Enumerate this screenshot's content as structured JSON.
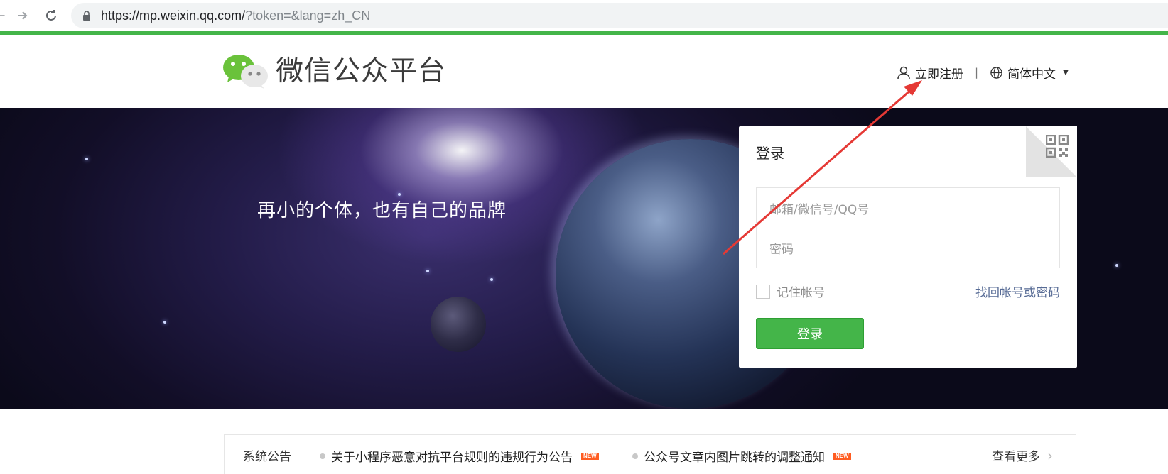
{
  "browser": {
    "url_host": "https://mp.weixin.qq.com/",
    "url_rest": "?token=&lang=zh_CN"
  },
  "header": {
    "brand_name": "微信公众平台",
    "register_label": "立即注册",
    "language_label": "简体中文",
    "separator": "|"
  },
  "banner": {
    "slogan": "再小的个体，也有自己的品牌"
  },
  "login": {
    "title": "登录",
    "account_placeholder": "邮箱/微信号/QQ号",
    "password_placeholder": "密码",
    "remember_label": "记住帐号",
    "forgot_label": "找回帐号或密码",
    "submit_label": "登录"
  },
  "notices": {
    "title": "系统公告",
    "items": [
      {
        "text": "关于小程序恶意对抗平台规则的违规行为公告",
        "badge": "NEW"
      },
      {
        "text": "公众号文章内图片跳转的调整通知",
        "badge": "NEW"
      }
    ],
    "more_label": "查看更多"
  },
  "colors": {
    "brand_green": "#44b549",
    "link_blue": "#576b95",
    "annotation_red": "#e53935",
    "new_badge": "#ff5c21"
  }
}
